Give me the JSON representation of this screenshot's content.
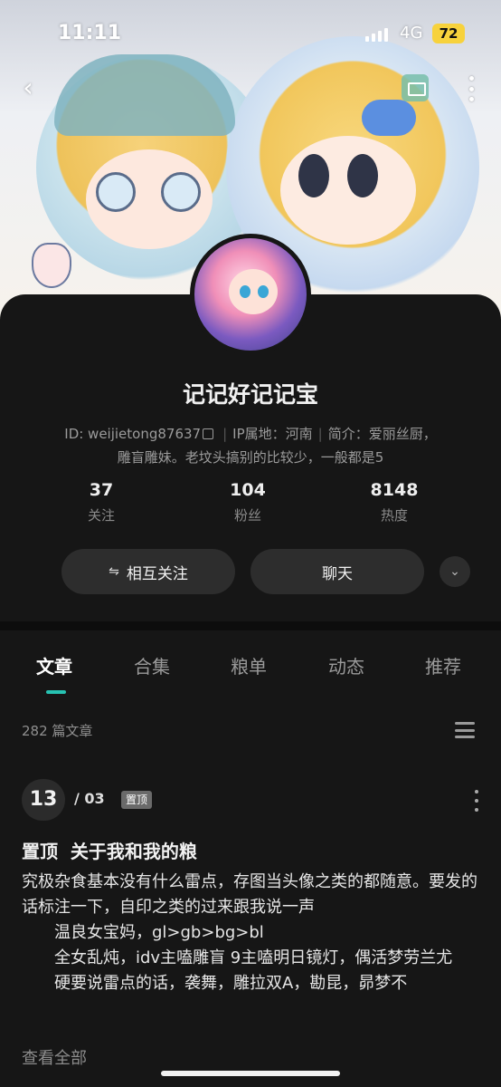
{
  "status_bar": {
    "time": "11:11",
    "network": "4G",
    "battery": "72"
  },
  "header": {
    "back_icon": "chevron-left-icon",
    "message_icon": "mail-icon",
    "more_icon": "more-vertical-icon"
  },
  "profile": {
    "name": "记记好记记宝",
    "id_text": "ID: weijietong87637",
    "ip_text": "IP属地：河南",
    "bio_line1": "简介：爱丽丝厨，",
    "bio_line2": "雕盲雕妹。老坟头搞别的比较少，一般都是5",
    "stats": [
      {
        "value": "37",
        "label": "关注"
      },
      {
        "value": "104",
        "label": "粉丝"
      },
      {
        "value": "8148",
        "label": "热度"
      }
    ],
    "follow_label": "相互关注",
    "follow_icon": "⇋",
    "chat_label": "聊天",
    "expand_icon": "chevron-down-icon"
  },
  "tabs": [
    {
      "label": "文章",
      "active": true
    },
    {
      "label": "合集",
      "active": false
    },
    {
      "label": "粮单",
      "active": false
    },
    {
      "label": "动态",
      "active": false
    },
    {
      "label": "推荐",
      "active": false
    }
  ],
  "article_list": {
    "count_text": "282 篇文章",
    "view_icon": "list-icon"
  },
  "post": {
    "day": "13",
    "month": "/ 03",
    "pin_label": "置顶",
    "title": "置顶  关于我和我的粮",
    "lines": [
      "究极杂食基本没有什么雷点，存图当头像之类的都随意。要发的话标注一下，自印之类的过来跟我说一声",
      "温良女宝妈，gl>gb>bg>bl",
      "全女乱炖，idv主嗑雕盲  9主嗑明日镜灯，偶活梦劳兰尤",
      "硬要说雷点的话，袭舞，雕拉双A，勘昆，昴梦不"
    ],
    "view_all": "查看全部"
  },
  "colors": {
    "accent": "#27c2b2",
    "background": "#161616",
    "button": "#2d2d2d",
    "battery": "#f7d23c"
  }
}
